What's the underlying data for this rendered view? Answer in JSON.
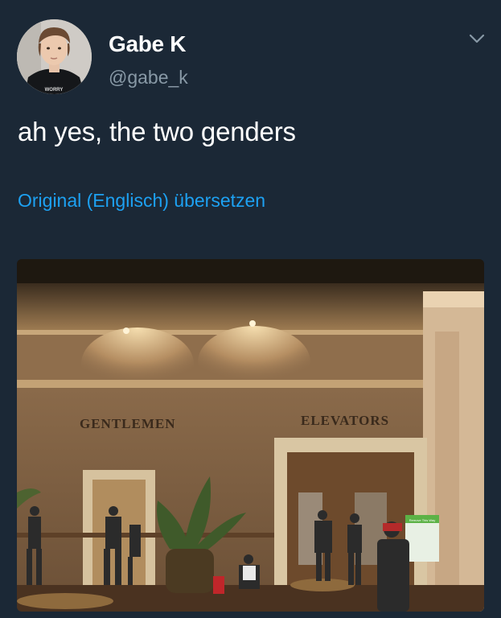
{
  "author": {
    "display_name": "Gabe K",
    "handle": "@gabe_k",
    "shirt_text": "WORRY"
  },
  "tweet": {
    "text": "ah yes, the two genders",
    "translate_label": "Original (Englisch) übersetzen"
  },
  "photo": {
    "sign_left": "GENTLEMEN",
    "sign_right": "ELEVATORS",
    "small_sign": "Remove This Way"
  },
  "icons": {
    "menu": "chevron-down-icon"
  },
  "colors": {
    "background": "#1b2836",
    "secondary_text": "#8899a6",
    "link": "#1da1f2"
  }
}
